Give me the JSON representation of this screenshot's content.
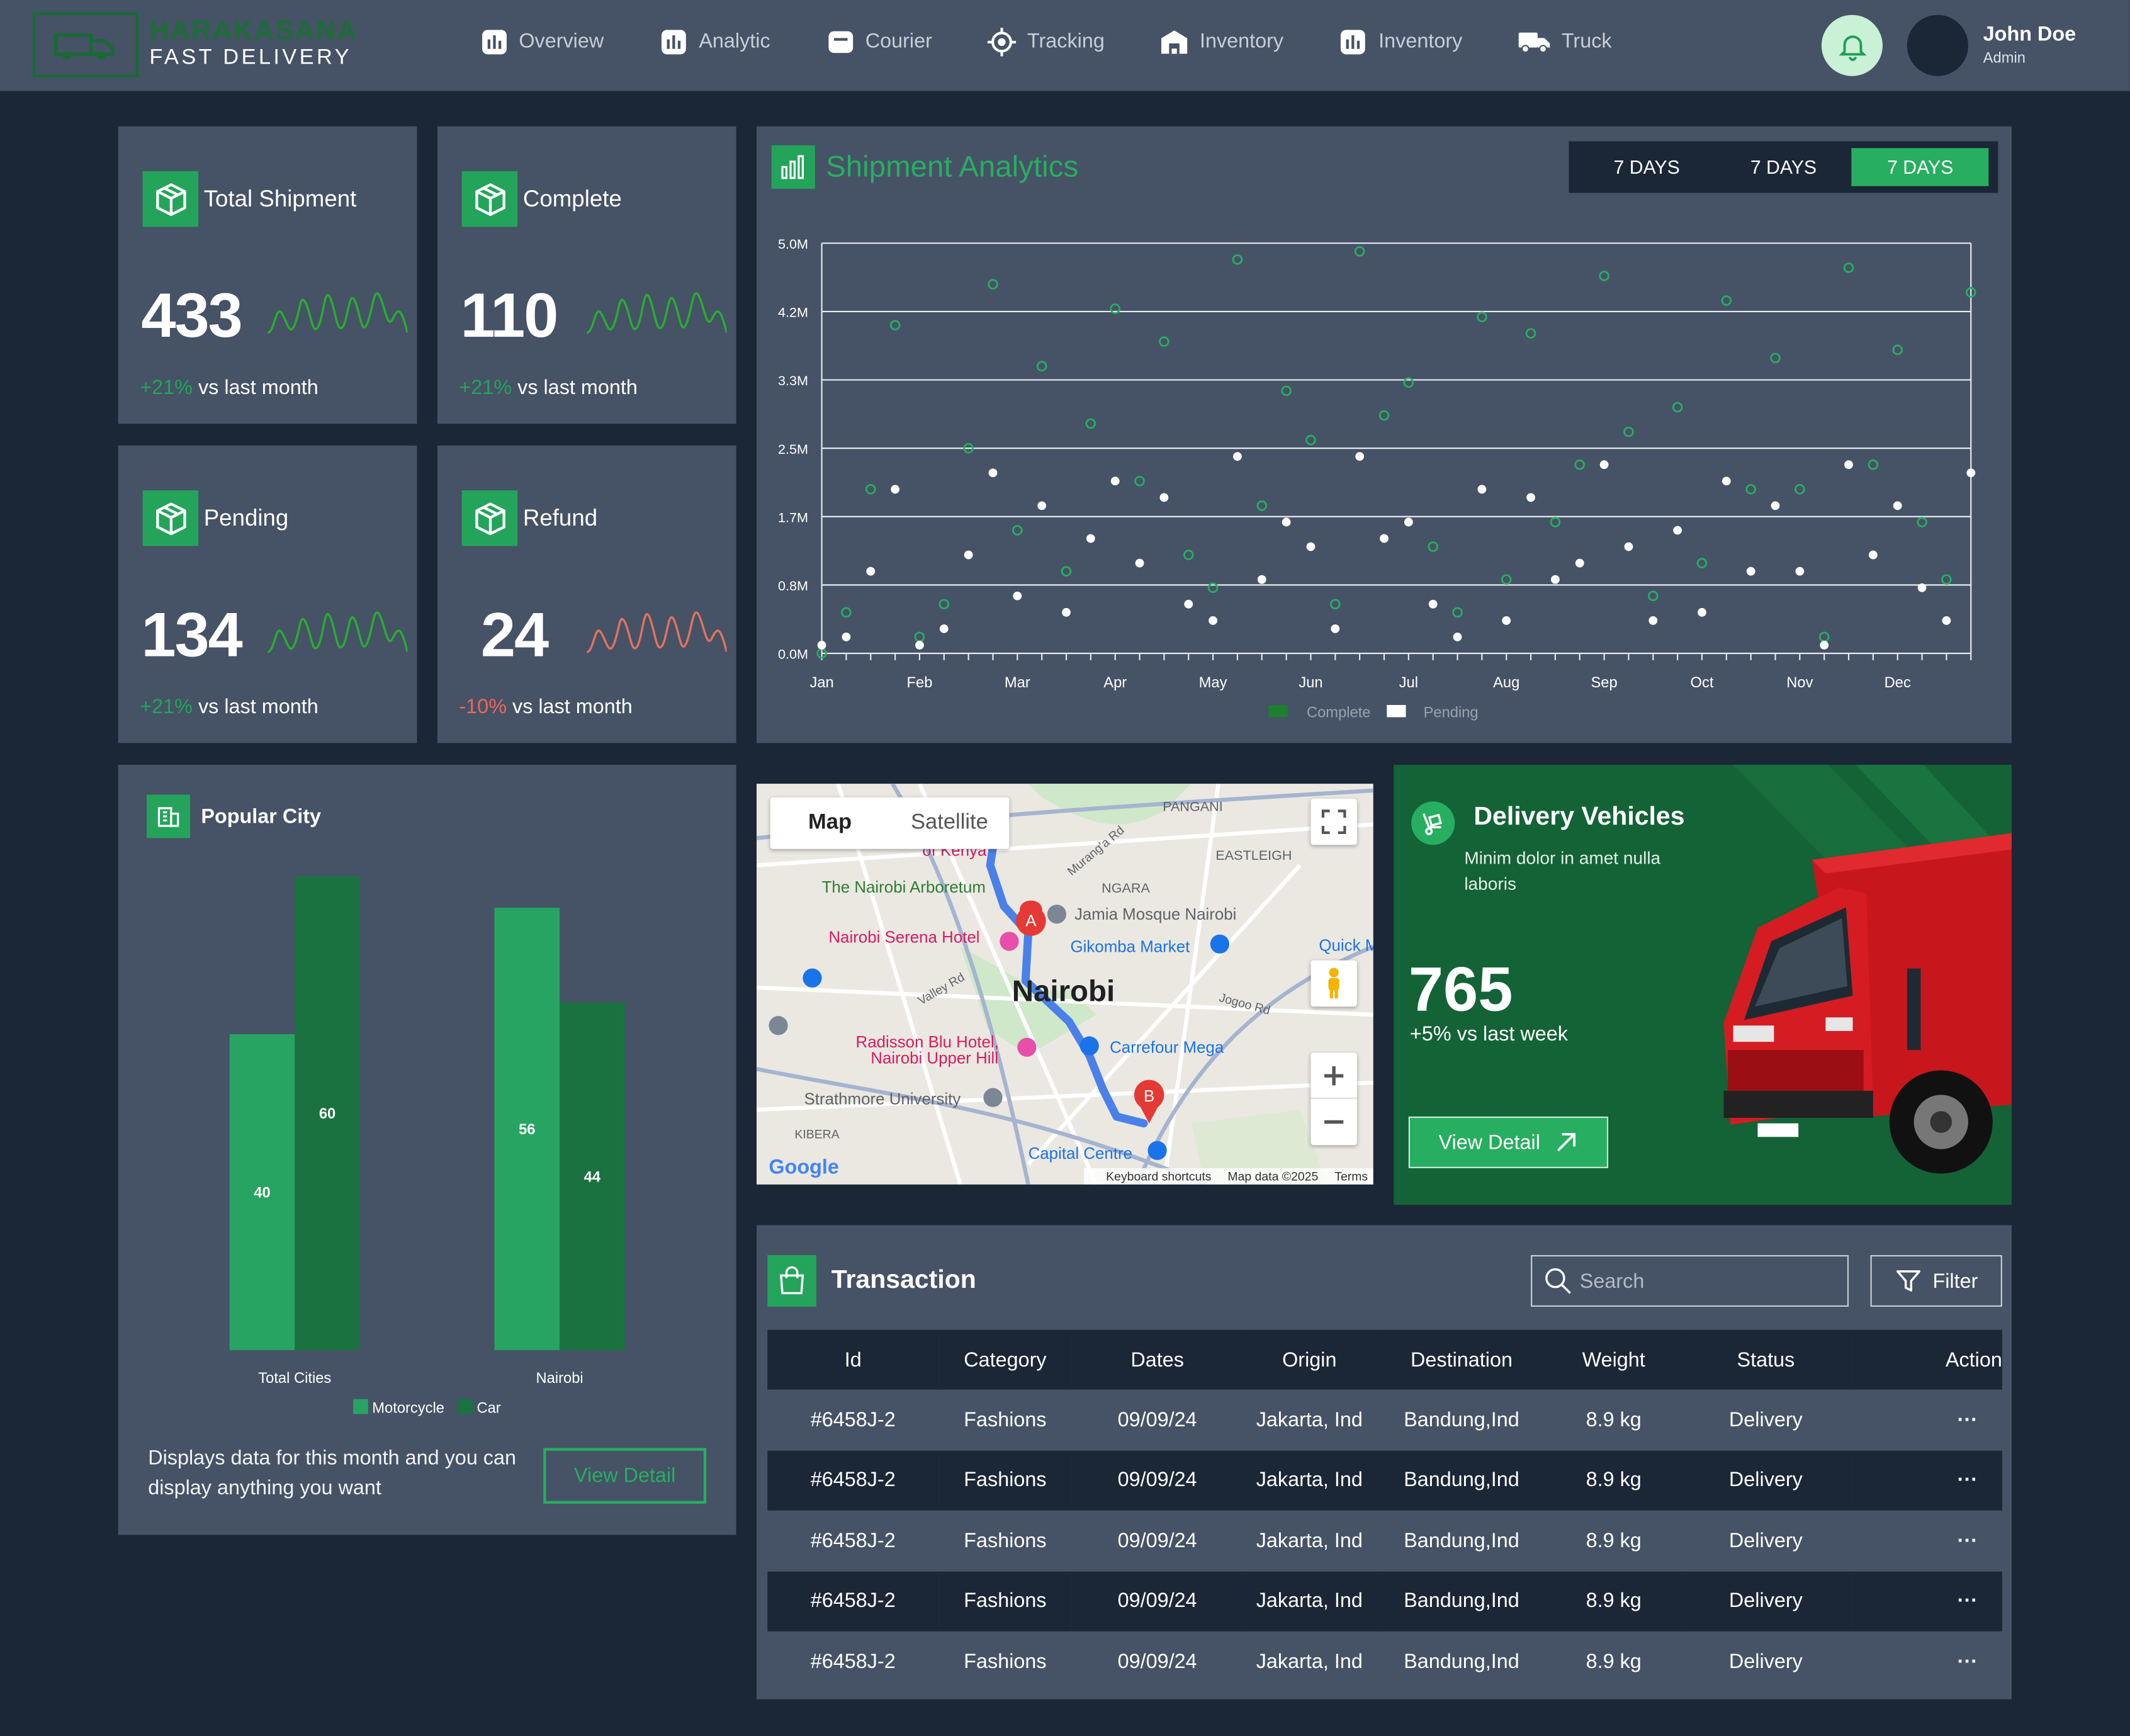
{
  "brand": {
    "name_top": "HARAKASANA",
    "name_bottom": "FAST DELIVERY"
  },
  "nav": [
    {
      "label": "Overview",
      "icon": "bar-chart-icon"
    },
    {
      "label": "Analytic",
      "icon": "bar-chart-icon"
    },
    {
      "label": "Courier",
      "icon": "courier-box-icon"
    },
    {
      "label": "Tracking",
      "icon": "crosshair-icon"
    },
    {
      "label": "Inventory",
      "icon": "warehouse-icon"
    },
    {
      "label": "Inventory",
      "icon": "bar-chart-icon"
    },
    {
      "label": "Truck",
      "icon": "truck-icon"
    }
  ],
  "user": {
    "name": "John Doe",
    "role": "Admin"
  },
  "stats": [
    {
      "title": "Total Shipment",
      "value": "433",
      "change": "+21%",
      "suffix": "vs last month",
      "trend": "up"
    },
    {
      "title": "Complete",
      "value": "110",
      "change": "+21%",
      "suffix": "vs last month",
      "trend": "up"
    },
    {
      "title": "Pending",
      "value": "134",
      "change": "+21%",
      "suffix": "vs last month",
      "trend": "up"
    },
    {
      "title": "Refund",
      "value": "24",
      "change": "-10%",
      "suffix": "vs last month",
      "trend": "down"
    }
  ],
  "shipment": {
    "title": "Shipment Analytics",
    "ranges": [
      "7 DAYS",
      "7 DAYS",
      "7 DAYS"
    ],
    "active_range": 2
  },
  "popular_city": {
    "title": "Popular City",
    "description": "Displays data for this month and you can display anything you want",
    "button": "View Detail"
  },
  "map": {
    "tab_map": "Map",
    "tab_satellite": "Satellite",
    "city": "Nairobi",
    "places": [
      "The Nairobi Arboretum",
      "Nairobi Serena Hotel",
      "Jamia Mosque Nairobi",
      "Gikomba Market",
      "Radisson Blu Hotel,",
      "Nairobi Upper Hill",
      "Carrefour Mega",
      "Strathmore University",
      "Capital Centre",
      "PANGANI",
      "EASTLEIGH",
      "NGARA",
      "KIBERA",
      "Valley Rd",
      "Jogoo Rd",
      "Murang'a Rd",
      "of Kenya",
      "Quick M"
    ],
    "pin_a": "A",
    "pin_b": "B",
    "footer": [
      "Keyboard shortcuts",
      "Map data ©2025",
      "Terms"
    ],
    "google": "Google"
  },
  "vehicles": {
    "title": "Delivery Vehicles",
    "description": "Minim dolor in amet nulla laboris",
    "value": "765",
    "sub": "+5% vs last week",
    "button": "View Detail"
  },
  "transaction": {
    "title": "Transaction",
    "search_placeholder": "Search",
    "filter": "Filter",
    "columns": [
      "Id",
      "Category",
      "Dates",
      "Origin",
      "Destination",
      "Weight",
      "Status",
      "Action"
    ],
    "rows": [
      [
        "#6458J-2",
        "Fashions",
        "09/09/24",
        "Jakarta, Ind",
        "Bandung,Ind",
        "8.9 kg",
        "Delivery",
        "···"
      ],
      [
        "#6458J-2",
        "Fashions",
        "09/09/24",
        "Jakarta, Ind",
        "Bandung,Ind",
        "8.9 kg",
        "Delivery",
        "···"
      ],
      [
        "#6458J-2",
        "Fashions",
        "09/09/24",
        "Jakarta, Ind",
        "Bandung,Ind",
        "8.9 kg",
        "Delivery",
        "···"
      ],
      [
        "#6458J-2",
        "Fashions",
        "09/09/24",
        "Jakarta, Ind",
        "Bandung,Ind",
        "8.9 kg",
        "Delivery",
        "···"
      ],
      [
        "#6458J-2",
        "Fashions",
        "09/09/24",
        "Jakarta, Ind",
        "Bandung,Ind",
        "8.9 kg",
        "Delivery",
        "···"
      ]
    ]
  },
  "colors": {
    "accent": "#27ae60",
    "bg": "#1b2636",
    "panel": "#465266",
    "dark_green": "#136336",
    "down": "#e86a5c"
  },
  "chart_data": [
    {
      "type": "scatter",
      "title": "Shipment Analytics",
      "x_categories": [
        "Jan",
        "Feb",
        "Mar",
        "Apr",
        "May",
        "Jun",
        "Jul",
        "Aug",
        "Sep",
        "Oct",
        "Nov",
        "Dec"
      ],
      "y_ticks": [
        "0.0M",
        "0.8M",
        "1.7M",
        "2.5M",
        "3.3M",
        "4.2M",
        "5.0M"
      ],
      "ylim": [
        0,
        5.0
      ],
      "grid": true,
      "legend_position": "bottom",
      "series": [
        {
          "name": "Complete",
          "color": "#27ae60",
          "values": [
            0.0,
            0.5,
            2.0,
            4.0,
            0.2,
            0.6,
            2.5,
            4.5,
            1.5,
            3.5,
            1.0,
            2.8,
            4.2,
            2.1,
            3.8,
            1.2,
            0.8,
            4.8,
            1.8,
            3.2,
            2.6,
            0.6,
            4.9,
            2.9,
            3.3,
            1.3,
            0.5,
            4.1,
            0.9,
            3.9,
            1.6,
            2.3,
            4.6,
            2.7,
            0.7,
            3.0,
            1.1,
            4.3,
            2.0,
            3.6,
            2.0,
            0.2,
            4.7,
            2.3,
            3.7,
            1.6,
            0.9,
            4.4
          ]
        },
        {
          "name": "Pending",
          "color": "#ffffff",
          "values": [
            0.1,
            0.2,
            1.0,
            2.0,
            0.1,
            0.3,
            1.2,
            2.2,
            0.7,
            1.8,
            0.5,
            1.4,
            2.1,
            1.1,
            1.9,
            0.6,
            0.4,
            2.4,
            0.9,
            1.6,
            1.3,
            0.3,
            2.4,
            1.4,
            1.6,
            0.6,
            0.2,
            2.0,
            0.4,
            1.9,
            0.9,
            1.1,
            2.3,
            1.3,
            0.4,
            1.5,
            0.5,
            2.1,
            1.0,
            1.8,
            1.0,
            0.1,
            2.3,
            1.2,
            1.8,
            0.8,
            0.4,
            2.2
          ]
        }
      ]
    },
    {
      "type": "bar",
      "title": "Popular City",
      "categories": [
        "Total Cities",
        "Nairobi"
      ],
      "series": [
        {
          "name": "Motorcycle",
          "color": "#27a462",
          "values": [
            40,
            56
          ]
        },
        {
          "name": "Car",
          "color": "#1b7241",
          "values": [
            60,
            44
          ]
        }
      ],
      "ylim": [
        0,
        60
      ],
      "legend_position": "bottom"
    }
  ]
}
